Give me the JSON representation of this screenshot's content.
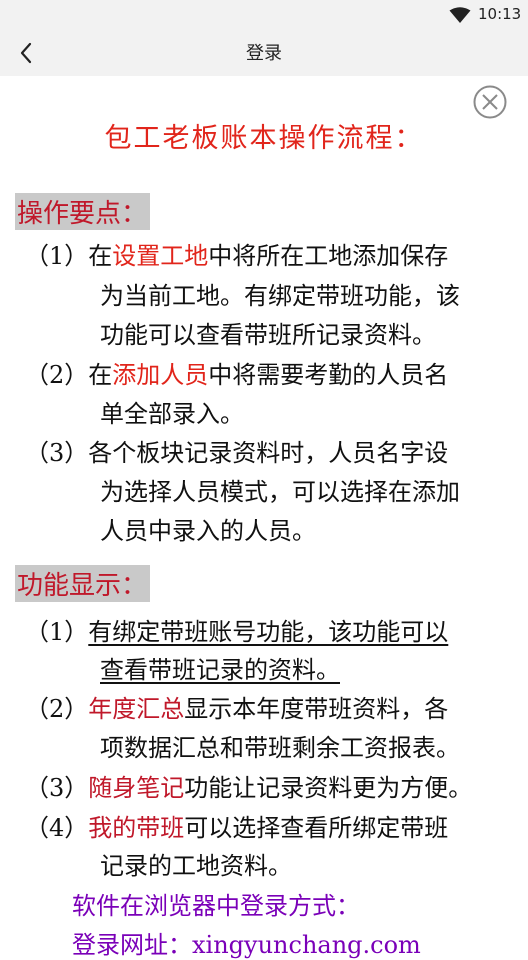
{
  "status_bar": {
    "time": "10:13",
    "icon": "wifi-icon"
  },
  "nav": {
    "title": "登录",
    "back_icon": "chevron-left-icon"
  },
  "document": {
    "close_icon": "close-circle-icon",
    "title": "包工老板账本操作流程：",
    "section1": {
      "heading": "操作要点：",
      "item1": {
        "num": "（1）",
        "pre": "在",
        "highlight": "设置工地",
        "rest": "中将所在工地添加保存",
        "cont1": "为当前工地。有绑定带班功能，该",
        "cont2": "功能可以查看带班所记录资料。"
      },
      "item2": {
        "num": "（2）",
        "pre": "在",
        "highlight": "添加人员",
        "rest": "中将需要考勤的人员名",
        "cont1": "单全部录入。"
      },
      "item3": {
        "num": "（3）",
        "text": "各个板块记录资料时，人员名字设",
        "cont1": "为选择人员模式，可以选择在添加",
        "cont2": "人员中录入的人员。"
      }
    },
    "section2": {
      "heading": "功能显示：",
      "item1": {
        "num": "（1）",
        "text": "有绑定带班账号功能，该功能可以",
        "cont1": "查看带班记录的资料。"
      },
      "item2": {
        "num": "（2）",
        "highlight": "年度汇总",
        "rest": "显示本年度带班资料，各",
        "cont1": "项数据汇总和带班剩余工资报表。"
      },
      "item3": {
        "num": "（3）",
        "highlight": "随身笔记",
        "rest": "功能让记录资料更为方便。"
      },
      "item4": {
        "num": "（4）",
        "highlight": "我的带班",
        "rest": "可以选择查看所绑定带班",
        "cont1": "记录的工地资料。"
      }
    },
    "browser_login": {
      "line1": "软件在浏览器中登录方式：",
      "line2": "登录网址：xingyunchang.com"
    }
  }
}
